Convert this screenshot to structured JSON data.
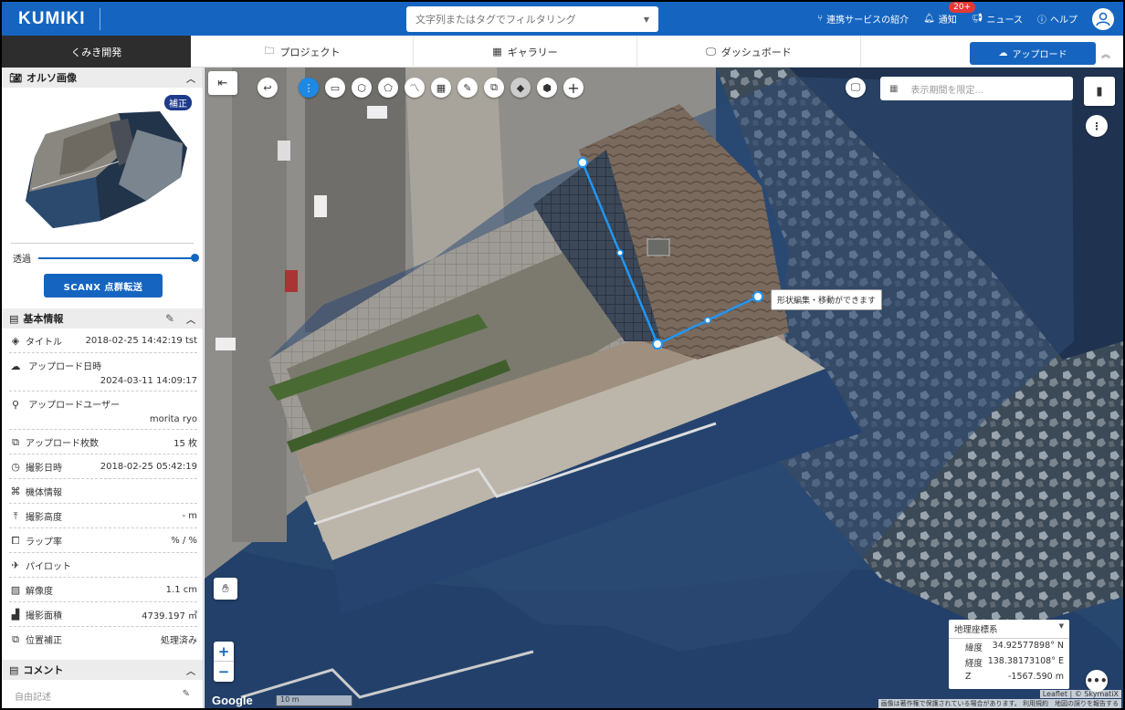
{
  "app": {
    "logo": "KUMIKI"
  },
  "search": {
    "placeholder": "文字列またはタグでフィルタリング"
  },
  "top_right": {
    "integration": "連携サービスの紹介",
    "notifications": "通知",
    "notification_badge": "20+",
    "news": "ニュース",
    "help": "ヘルプ"
  },
  "nav": {
    "org": "くみき開発",
    "tabs": [
      "プロジェクト",
      "ギャラリー",
      "ダッシュボード"
    ],
    "upload": "アップロード"
  },
  "ortho": {
    "title": "オルソ画像",
    "badge": "補正",
    "opacity_label": "透過",
    "opacity_value": 1.0,
    "scanx_button": "SCANX 点群転送"
  },
  "basic_info": {
    "title": "基本情報",
    "rows": [
      {
        "label": "タイトル",
        "value": "2018-02-25 14:42:19 tst",
        "icon": "layers-icon"
      },
      {
        "label": "アップロード日時",
        "value": "2024-03-11 14:09:17",
        "icon": "cloud-upload-icon"
      },
      {
        "label": "アップロードユーザー",
        "value": "morita ryo",
        "icon": "user-icon"
      },
      {
        "label": "アップロード枚数",
        "value": "15 枚",
        "icon": "images-icon"
      },
      {
        "label": "撮影日時",
        "value": "2018-02-25 05:42:19",
        "icon": "clock-icon"
      },
      {
        "label": "機体情報",
        "value": "",
        "icon": "drone-icon"
      },
      {
        "label": "撮影高度",
        "value": "- m",
        "icon": "altitude-icon"
      },
      {
        "label": "ラップ率",
        "value": "% / %",
        "icon": "overlap-icon"
      },
      {
        "label": "パイロット",
        "value": "",
        "icon": "pilot-icon"
      },
      {
        "label": "解像度",
        "value": "1.1 cm",
        "icon": "resolution-icon"
      },
      {
        "label": "撮影面積",
        "value": "4739.197 ㎡",
        "icon": "area-icon"
      },
      {
        "label": "位置補正",
        "value": "処理済み",
        "icon": "position-icon"
      }
    ]
  },
  "comment": {
    "title": "コメント",
    "placeholder": "自由記述"
  },
  "map": {
    "period_placeholder": "表示期間を限定...",
    "tooltip": "形状編集・移動ができます",
    "coord_system": "地理座標系",
    "lat_label": "緯度",
    "lat": "34.92577898° N",
    "lng_label": "経度",
    "lng": "138.38173108° E",
    "z_label": "Z",
    "z": "-1567.590 m",
    "google": "Google",
    "scale": "10 m",
    "attribution": "Leaflet | © SkymatiX",
    "attribution2": "画像は著作権で保護されている場合があります。 利用規約　地図の誤りを報告する",
    "zoom_in": "+",
    "zoom_out": "−"
  },
  "colors": {
    "brand": "#1565c0",
    "org_bg": "#2d2d2d",
    "active_tool": "#1e88e5",
    "line": "#2196f3"
  }
}
